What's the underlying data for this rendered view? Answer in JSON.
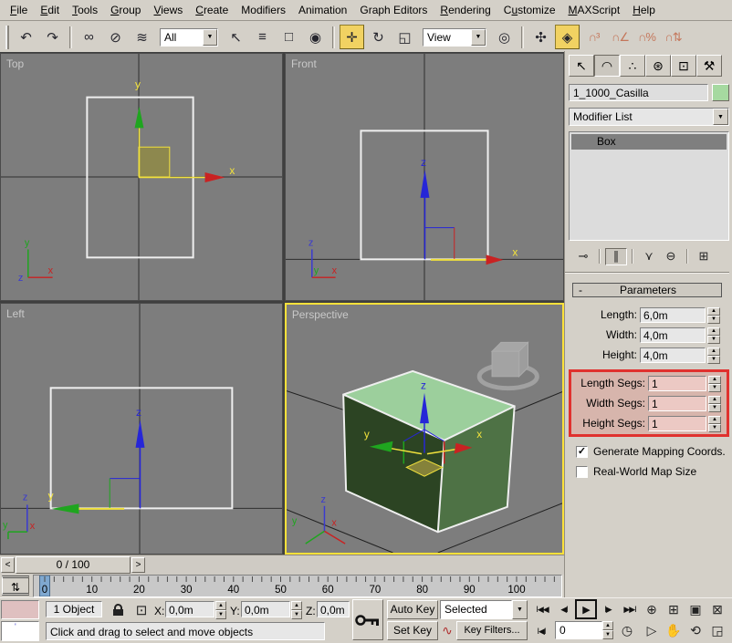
{
  "menubar": {
    "items": [
      {
        "label": "File",
        "u": 0
      },
      {
        "label": "Edit",
        "u": 0
      },
      {
        "label": "Tools",
        "u": 0
      },
      {
        "label": "Group",
        "u": 0
      },
      {
        "label": "Views",
        "u": 0
      },
      {
        "label": "Create",
        "u": 0
      },
      {
        "label": "Modifiers",
        "u": -1
      },
      {
        "label": "Animation",
        "u": -1
      },
      {
        "label": "Graph Editors",
        "u": -1
      },
      {
        "label": "Rendering",
        "u": 0
      },
      {
        "label": "Customize",
        "u": 1
      },
      {
        "label": "MAXScript",
        "u": 0
      },
      {
        "label": "Help",
        "u": 0
      }
    ]
  },
  "toolbar": {
    "items": [
      {
        "name": "undo-icon",
        "glyph": "↶"
      },
      {
        "name": "redo-icon",
        "glyph": "↷"
      },
      {
        "type": "sep"
      },
      {
        "name": "select-and-link-icon",
        "glyph": "∞"
      },
      {
        "name": "unlink-selection-icon",
        "glyph": "⊘"
      },
      {
        "name": "bind-to-space-warp-icon",
        "glyph": "≋"
      },
      {
        "type": "dropdown",
        "name": "selection-filter-dropdown",
        "label": "All",
        "w": 64
      },
      {
        "name": "select-object-icon",
        "glyph": "↖"
      },
      {
        "name": "select-by-name-icon",
        "glyph": "≡"
      },
      {
        "name": "rectangular-selection-region-icon",
        "glyph": "□"
      },
      {
        "name": "window-crossing-toggle-icon",
        "glyph": "◉"
      },
      {
        "type": "sep"
      },
      {
        "name": "select-and-move-icon",
        "glyph": "✛",
        "active": true
      },
      {
        "name": "select-and-rotate-icon",
        "glyph": "↻"
      },
      {
        "name": "select-and-scale-icon",
        "glyph": "◱"
      },
      {
        "type": "dropdown",
        "name": "reference-coordinate-system-dropdown",
        "label": "View",
        "w": 70
      },
      {
        "name": "use-pivot-point-center-icon",
        "glyph": "◎"
      },
      {
        "type": "sep"
      },
      {
        "name": "select-and-manipulate-icon",
        "glyph": "✣"
      },
      {
        "name": "snaps-toggle-icon",
        "glyph": "◈",
        "active": true
      },
      {
        "name": "snap-3d-icon",
        "glyph": "∩³",
        "magnet": true
      },
      {
        "name": "angle-snap-icon",
        "glyph": "∩∠",
        "magnet": true
      },
      {
        "name": "percent-snap-icon",
        "glyph": "∩%",
        "magnet": true
      },
      {
        "name": "spinner-snap-icon",
        "glyph": "∩⇅",
        "magnet": true
      }
    ]
  },
  "viewports": {
    "top": {
      "label": "Top"
    },
    "front": {
      "label": "Front"
    },
    "left": {
      "label": "Left"
    },
    "perspective": {
      "label": "Perspective"
    },
    "axis": {
      "x": "x",
      "y": "y",
      "z": "z"
    }
  },
  "command_panel": {
    "tabs": [
      {
        "name": "tab-create",
        "glyph": "↖"
      },
      {
        "name": "tab-modify",
        "glyph": "◠",
        "active": true
      },
      {
        "name": "tab-hierarchy",
        "glyph": "∴"
      },
      {
        "name": "tab-motion",
        "glyph": "⊛"
      },
      {
        "name": "tab-display",
        "glyph": "⊡"
      },
      {
        "name": "tab-utilities",
        "glyph": "⚒"
      }
    ],
    "object_name": "1_1000_Casilla",
    "object_color": "#a6d9a0",
    "modifier_list_label": "Modifier List",
    "stack": [
      "Box"
    ],
    "stack_buttons": [
      {
        "name": "pin-stack-icon",
        "glyph": "⊸"
      },
      {
        "name": "show-end-result-icon",
        "glyph": "∥",
        "active": true
      },
      {
        "name": "make-unique-icon",
        "glyph": "⋎"
      },
      {
        "name": "remove-modifier-icon",
        "glyph": "⊖"
      },
      {
        "name": "configure-modifier-sets-icon",
        "glyph": "⊞"
      }
    ],
    "parameters": {
      "collapse": "-",
      "title": "Parameters",
      "rows": [
        {
          "label": "Length:",
          "value": "6,0m"
        },
        {
          "label": "Width:",
          "value": "4,0m"
        },
        {
          "label": "Height:",
          "value": "4,0m"
        }
      ],
      "seg_rows": [
        {
          "label": "Length Segs:",
          "value": "1"
        },
        {
          "label": "Width Segs:",
          "value": "1"
        },
        {
          "label": "Height Segs:",
          "value": "1"
        }
      ],
      "checkboxes": [
        {
          "label": "Generate Mapping Coords.",
          "checked": true,
          "mark": "✓"
        },
        {
          "label": "Real-World Map Size",
          "checked": false,
          "mark": ""
        }
      ]
    }
  },
  "time_slider": {
    "prev": "<",
    "value": "0 / 100",
    "next": ">"
  },
  "trackbar": {
    "tick_labels": [
      "0",
      "10",
      "20",
      "30",
      "40",
      "50",
      "60",
      "70",
      "80",
      "90",
      "100"
    ],
    "current_frame": 0
  },
  "status_bar": {
    "object_count": "1 Object",
    "x_label": "X:",
    "y_label": "Y:",
    "z_label": "Z:",
    "x_value": "0,0m",
    "y_value": "0,0m",
    "z_value": "0,0m",
    "prompt": "Click and drag to select and move objects",
    "absolute_mode_glyph": "⊡"
  },
  "animation_controls": {
    "auto_key": "Auto Key",
    "set_key": "Set Key",
    "selection_set": "Selected",
    "key_filters": "Key Filters...",
    "frame_field": "0",
    "curve_glyph": "∿",
    "key_mode_glyph": "Ι◀Ι",
    "time_config_glyph": "◷",
    "playback": [
      {
        "name": "go-to-start-button",
        "glyph": "Ι◀◀"
      },
      {
        "name": "previous-frame-button",
        "glyph": "◀Ι"
      },
      {
        "name": "play-button",
        "glyph": "▶",
        "boxed": true
      },
      {
        "name": "next-frame-button",
        "glyph": "Ι▶"
      },
      {
        "name": "go-to-end-button",
        "glyph": "▶▶Ι"
      }
    ]
  },
  "viewport_nav": {
    "row1": [
      {
        "name": "zoom-button",
        "glyph": "⊕"
      },
      {
        "name": "zoom-all-button",
        "glyph": "⊞"
      },
      {
        "name": "zoom-extents-button",
        "glyph": "▣"
      },
      {
        "name": "zoom-extents-all-button",
        "glyph": "⊠"
      }
    ],
    "row2": [
      {
        "name": "field-of-view-button",
        "glyph": "▷"
      },
      {
        "name": "pan-button",
        "glyph": "✋"
      },
      {
        "name": "arc-rotate-button",
        "glyph": "⟲"
      },
      {
        "name": "min-max-toggle-button",
        "glyph": "◲"
      }
    ]
  },
  "colors": {
    "viewport_bg": "#7d7d7d",
    "active_viewport_border": "#fde13a",
    "annotation_red": "#e0312e",
    "toolbar_active": "#f1d262",
    "selection_marker_blue": "#7fa8d0",
    "object_color_swatch": "#a6d9a0",
    "box_top_face": "#9ccf9c",
    "box_left_face": "#2c4423",
    "box_right_face": "#4e7245"
  }
}
